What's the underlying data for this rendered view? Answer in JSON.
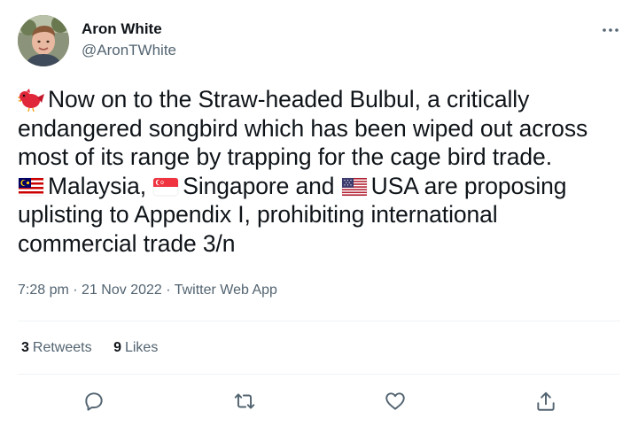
{
  "author": {
    "name": "Aron White",
    "handle": "@AronTWhite"
  },
  "tweet": {
    "lines": [
      {
        "emoji": "bird-emoji",
        "text": "Now on to the Straw-headed Bulbul, a critically"
      },
      {
        "text": "endangered songbird which has been wiped out across"
      },
      {
        "text": "most of its range by trapping for the cage bird trade."
      },
      {
        "segments": [
          {
            "flag": "malaysia-flag-emoji",
            "text": "Malaysia, "
          },
          {
            "flag": "singapore-flag-emoji",
            "text": "Singapore and "
          },
          {
            "flag": "usa-flag-emoji",
            "text": "USA are proposing"
          }
        ]
      },
      {
        "text": "uplisting to Appendix I, prohibiting international"
      },
      {
        "text": "commercial trade 3/n"
      }
    ]
  },
  "meta": {
    "time": "7:28 pm",
    "date": "21 Nov 2022",
    "source": "Twitter Web App",
    "separator": "·"
  },
  "stats": {
    "retweets_count": "3",
    "retweets_label": "Retweets",
    "likes_count": "9",
    "likes_label": "Likes"
  },
  "actions": [
    "reply-icon",
    "retweet-icon",
    "like-icon",
    "share-icon"
  ],
  "colors": {
    "text": "#0f1419",
    "secondary": "#536471",
    "divider": "#eff3f4"
  }
}
